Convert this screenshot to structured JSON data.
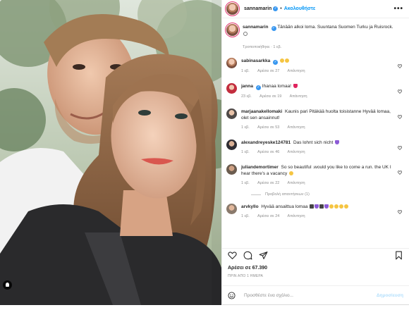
{
  "post": {
    "username": "sannamarin",
    "follow_label": "Ακολουθήστε",
    "more_label": "•••",
    "caption": {
      "username": "sannamarin",
      "text": "Tänään alkoi loma. Suuntana Suomen Turku ja Ruisrock.",
      "meta": "Τροποποιήθηκε · 1 εβ."
    },
    "comments": [
      {
        "username": "sabinasarkka",
        "text": "",
        "time": "1 εβ.",
        "likes": "Αρέσει σε 27",
        "reply": "Απάντηση",
        "emojis": [
          "yellow",
          "yellow"
        ]
      },
      {
        "username": "janna",
        "text": "Ihanaa lomaa!",
        "time": "23 εβ.",
        "likes": "Αρέσει σε 19",
        "reply": "Απάντηση",
        "emojis": [
          "red"
        ]
      },
      {
        "username": "marjaanakellomaki",
        "text": "Kaunis pari Pitäkää huolta toisistanne Hyvää lomaa, olet sen ansainnut!",
        "time": "1 εβ.",
        "likes": "Αρέσει σε 53",
        "reply": "Απάντηση",
        "emojis": []
      },
      {
        "username": "alexandreyeske124781",
        "text": "Das lohnt sich nicht",
        "time": "1 εβ.",
        "likes": "Αρέσει σε 46",
        "reply": "Απάντηση",
        "emojis": [
          "purple"
        ]
      },
      {
        "username": "juliandemortimer",
        "text": "So so beautiful .would you like to come a run. the UK I hear there's a vacancy",
        "time": "1 εβ.",
        "likes": "Αρέσει σε 22",
        "reply": "Απάντηση",
        "emojis": [
          "yellow"
        ],
        "view_replies": "Προβολή απαντήσεων (1)"
      },
      {
        "username": "arvkyllo",
        "text": "Hyvää ansaittua lomaa",
        "time": "1 εβ.",
        "likes": "Αρέσει σε 24",
        "reply": "Απάντηση",
        "emojis": [
          "dark",
          "purple",
          "dark",
          "purple",
          "yellow",
          "yellow",
          "yellow",
          "yellow"
        ]
      }
    ],
    "likes_count": "Αρέσει σε 67.390",
    "time_ago": "ΠΡΙΝ ΑΠΟ 1 ΗΜΕΡΑ",
    "add_comment": {
      "placeholder": "Προσθέστε ένα σχόλιο...",
      "post_label": "Δημοσίευση"
    },
    "colors": {
      "accent": "#0095f6",
      "text": "#262626",
      "muted": "#8e8e8e",
      "like_red": "#ed4956"
    },
    "icons": [
      "heart-icon",
      "comment-icon",
      "share-icon",
      "bookmark-icon",
      "emoji-icon",
      "more-options-icon",
      "verified-badge-icon",
      "tagged-user-icon"
    ]
  }
}
